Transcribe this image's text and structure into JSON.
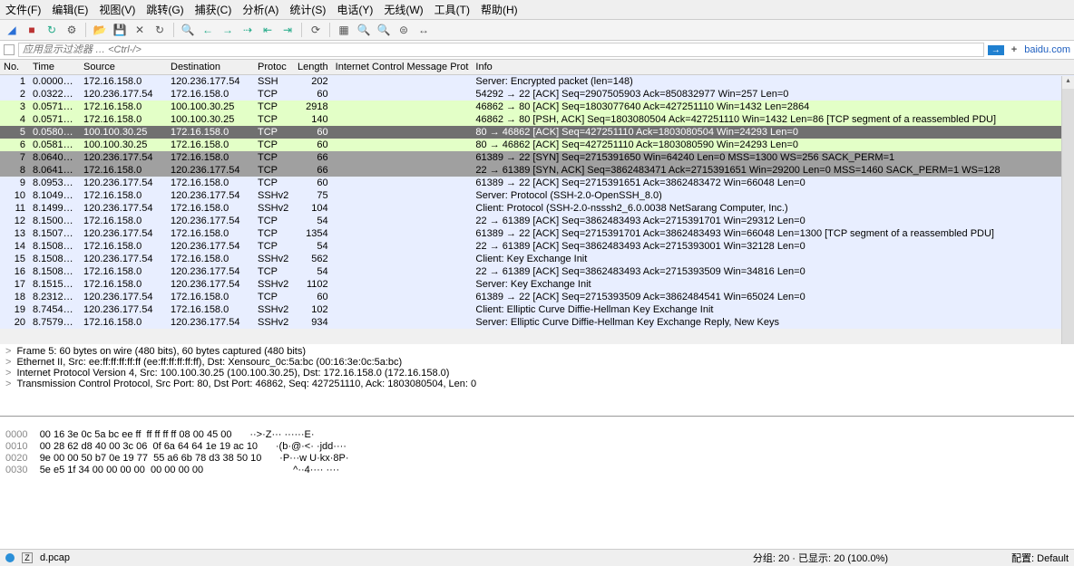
{
  "menu": {
    "file": "文件(F)",
    "edit": "编辑(E)",
    "view": "视图(V)",
    "go": "跳转(G)",
    "capture": "捕获(C)",
    "analyze": "分析(A)",
    "stats": "统计(S)",
    "tel": "电话(Y)",
    "wireless": "无线(W)",
    "tools": "工具(T)",
    "help": "帮助(H)"
  },
  "filter": {
    "placeholder": "应用显示过滤器 … <Ctrl-/>",
    "ext": "baidu.com"
  },
  "headers": {
    "no": "No.",
    "time": "Time",
    "src": "Source",
    "dst": "Destination",
    "proto": "Protoc",
    "len": "Length",
    "icmp": "Internet Control Message Prot",
    "info": "Info"
  },
  "packets": [
    {
      "no": "1",
      "time": "0.0000…",
      "src": "172.16.158.0",
      "dst": "120.236.177.54",
      "proto": "SSH",
      "len": "202",
      "info": "Server: Encrypted packet (len=148)",
      "cls": "normal"
    },
    {
      "no": "2",
      "time": "0.0322…",
      "src": "120.236.177.54",
      "dst": "172.16.158.0",
      "proto": "TCP",
      "len": "60",
      "info": "54292 → 22 [ACK] Seq=2907505903 Ack=850832977 Win=257 Len=0",
      "cls": "normal"
    },
    {
      "no": "3",
      "time": "0.0571…",
      "src": "172.16.158.0",
      "dst": "100.100.30.25",
      "proto": "TCP",
      "len": "2918",
      "info": "46862 → 80 [ACK] Seq=1803077640 Ack=427251110 Win=1432 Len=2864",
      "cls": "green"
    },
    {
      "no": "4",
      "time": "0.0571…",
      "src": "172.16.158.0",
      "dst": "100.100.30.25",
      "proto": "TCP",
      "len": "140",
      "info": "46862 → 80 [PSH, ACK] Seq=1803080504 Ack=427251110 Win=1432 Len=86 [TCP segment of a reassembled PDU]",
      "cls": "green"
    },
    {
      "no": "5",
      "time": "0.0580…",
      "src": "100.100.30.25",
      "dst": "172.16.158.0",
      "proto": "TCP",
      "len": "60",
      "info": "80 → 46862 [ACK] Seq=427251110 Ack=1803080504 Win=24293 Len=0",
      "cls": "sel"
    },
    {
      "no": "6",
      "time": "0.0581…",
      "src": "100.100.30.25",
      "dst": "172.16.158.0",
      "proto": "TCP",
      "len": "60",
      "info": "80 → 46862 [ACK] Seq=427251110 Ack=1803080590 Win=24293 Len=0",
      "cls": "green"
    },
    {
      "no": "7",
      "time": "8.0640…",
      "src": "120.236.177.54",
      "dst": "172.16.158.0",
      "proto": "TCP",
      "len": "66",
      "info": "61389 → 22 [SYN] Seq=2715391650 Win=64240 Len=0 MSS=1300 WS=256 SACK_PERM=1",
      "cls": "dark"
    },
    {
      "no": "8",
      "time": "8.0641…",
      "src": "172.16.158.0",
      "dst": "120.236.177.54",
      "proto": "TCP",
      "len": "66",
      "info": "22 → 61389 [SYN, ACK] Seq=3862483471 Ack=2715391651 Win=29200 Len=0 MSS=1460 SACK_PERM=1 WS=128",
      "cls": "dark"
    },
    {
      "no": "9",
      "time": "8.0953…",
      "src": "120.236.177.54",
      "dst": "172.16.158.0",
      "proto": "TCP",
      "len": "60",
      "info": "61389 → 22 [ACK] Seq=2715391651 Ack=3862483472 Win=66048 Len=0",
      "cls": "normal"
    },
    {
      "no": "10",
      "time": "8.1049…",
      "src": "172.16.158.0",
      "dst": "120.236.177.54",
      "proto": "SSHv2",
      "len": "75",
      "info": "Server: Protocol (SSH-2.0-OpenSSH_8.0)",
      "cls": "normal"
    },
    {
      "no": "11",
      "time": "8.1499…",
      "src": "120.236.177.54",
      "dst": "172.16.158.0",
      "proto": "SSHv2",
      "len": "104",
      "info": "Client: Protocol (SSH-2.0-nsssh2_6.0.0038 NetSarang Computer, Inc.)",
      "cls": "normal"
    },
    {
      "no": "12",
      "time": "8.1500…",
      "src": "172.16.158.0",
      "dst": "120.236.177.54",
      "proto": "TCP",
      "len": "54",
      "info": "22 → 61389 [ACK] Seq=3862483493 Ack=2715391701 Win=29312 Len=0",
      "cls": "normal"
    },
    {
      "no": "13",
      "time": "8.1507…",
      "src": "120.236.177.54",
      "dst": "172.16.158.0",
      "proto": "TCP",
      "len": "1354",
      "info": "61389 → 22 [ACK] Seq=2715391701 Ack=3862483493 Win=66048 Len=1300 [TCP segment of a reassembled PDU]",
      "cls": "normal"
    },
    {
      "no": "14",
      "time": "8.1508…",
      "src": "172.16.158.0",
      "dst": "120.236.177.54",
      "proto": "TCP",
      "len": "54",
      "info": "22 → 61389 [ACK] Seq=3862483493 Ack=2715393001 Win=32128 Len=0",
      "cls": "normal"
    },
    {
      "no": "15",
      "time": "8.1508…",
      "src": "120.236.177.54",
      "dst": "172.16.158.0",
      "proto": "SSHv2",
      "len": "562",
      "info": "Client: Key Exchange Init",
      "cls": "normal"
    },
    {
      "no": "16",
      "time": "8.1508…",
      "src": "172.16.158.0",
      "dst": "120.236.177.54",
      "proto": "TCP",
      "len": "54",
      "info": "22 → 61389 [ACK] Seq=3862483493 Ack=2715393509 Win=34816 Len=0",
      "cls": "normal"
    },
    {
      "no": "17",
      "time": "8.1515…",
      "src": "172.16.158.0",
      "dst": "120.236.177.54",
      "proto": "SSHv2",
      "len": "1102",
      "info": "Server: Key Exchange Init",
      "cls": "normal"
    },
    {
      "no": "18",
      "time": "8.2312…",
      "src": "120.236.177.54",
      "dst": "172.16.158.0",
      "proto": "TCP",
      "len": "60",
      "info": "61389 → 22 [ACK] Seq=2715393509 Ack=3862484541 Win=65024 Len=0",
      "cls": "normal"
    },
    {
      "no": "19",
      "time": "8.7454…",
      "src": "120.236.177.54",
      "dst": "172.16.158.0",
      "proto": "SSHv2",
      "len": "102",
      "info": "Client: Elliptic Curve Diffie-Hellman Key Exchange Init",
      "cls": "normal"
    },
    {
      "no": "20",
      "time": "8.7579…",
      "src": "172.16.158.0",
      "dst": "120.236.177.54",
      "proto": "SSHv2",
      "len": "934",
      "info": "Server: Elliptic Curve Diffie-Hellman Key Exchange Reply, New Keys",
      "cls": "normal"
    }
  ],
  "details": {
    "l1": "Frame 5: 60 bytes on wire (480 bits), 60 bytes captured (480 bits)",
    "l2": "Ethernet II, Src: ee:ff:ff:ff:ff:ff (ee:ff:ff:ff:ff:ff), Dst: Xensourc_0c:5a:bc (00:16:3e:0c:5a:bc)",
    "l3": "Internet Protocol Version 4, Src: 100.100.30.25 (100.100.30.25), Dst: 172.16.158.0 (172.16.158.0)",
    "l4": "Transmission Control Protocol, Src Port: 80, Dst Port: 46862, Seq: 427251110, Ack: 1803080504, Len: 0"
  },
  "hex": {
    "r0o": "0000",
    "r0h": "00 16 3e 0c 5a bc ee ff  ff ff ff ff 08 00 45 00",
    "r0a": "··>·Z··· ······E·",
    "r1o": "0010",
    "r1h": "00 28 62 d8 40 00 3c 06  0f 6a 64 64 1e 19 ac 10",
    "r1a": "·(b·@·<· ·jdd····",
    "r2o": "0020",
    "r2h": "9e 00 00 50 b7 0e 19 77  55 a6 6b 78 d3 38 50 10",
    "r2a": "·P···w U·kx·8P·",
    "r3o": "0030",
    "r3h": "5e e5 1f 34 00 00 00 00  00 00 00 00",
    "r3a": "^··4···· ····"
  },
  "status": {
    "file": "d.pcap",
    "counts": "分组: 20 · 已显示: 20 (100.0%)",
    "profile": "配置: Default"
  }
}
